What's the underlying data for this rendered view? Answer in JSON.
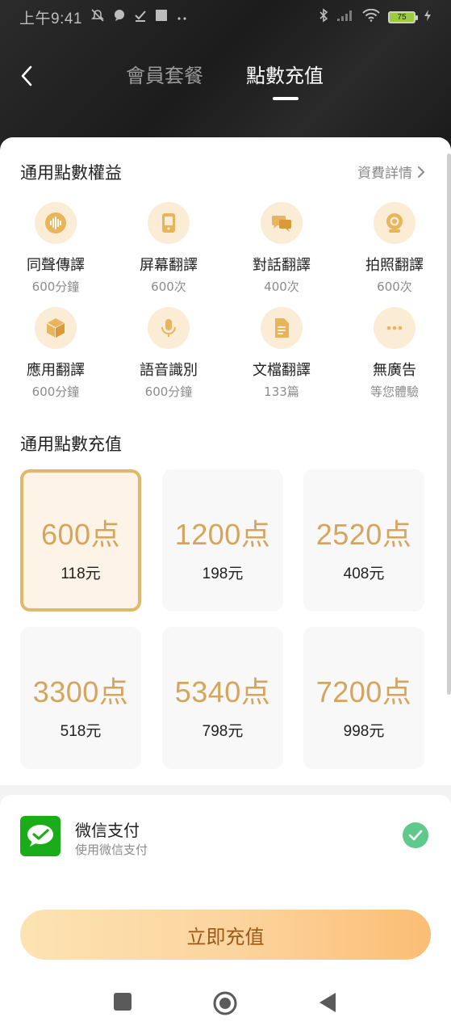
{
  "status_bar": {
    "time": "上午9:41",
    "battery": "75"
  },
  "nav": {
    "tabs": [
      {
        "label": "會員套餐",
        "active": false
      },
      {
        "label": "點數充值",
        "active": true
      }
    ]
  },
  "benefits_section": {
    "title": "通用點數權益",
    "details_link": "資費詳情",
    "items": [
      {
        "name": "同聲傳譯",
        "value": "600分鐘",
        "icon": "waveform-icon"
      },
      {
        "name": "屏幕翻譯",
        "value": "600次",
        "icon": "screen-icon"
      },
      {
        "name": "對話翻譯",
        "value": "400次",
        "icon": "chat-icon"
      },
      {
        "name": "拍照翻譯",
        "value": "600次",
        "icon": "camera-icon"
      },
      {
        "name": "應用翻譯",
        "value": "600分鐘",
        "icon": "cube-icon"
      },
      {
        "name": "語音識別",
        "value": "600分鐘",
        "icon": "microphone-icon"
      },
      {
        "name": "文檔翻譯",
        "value": "133篇",
        "icon": "document-icon"
      },
      {
        "name": "無廣告",
        "value": "等您體驗",
        "icon": "more-icon"
      }
    ]
  },
  "recharge_section": {
    "title": "通用點數充值",
    "packages": [
      {
        "points": "600点",
        "price": "118元",
        "selected": true
      },
      {
        "points": "1200点",
        "price": "198元",
        "selected": false
      },
      {
        "points": "2520点",
        "price": "408元",
        "selected": false
      },
      {
        "points": "3300点",
        "price": "518元",
        "selected": false
      },
      {
        "points": "5340点",
        "price": "798元",
        "selected": false
      },
      {
        "points": "7200点",
        "price": "998元",
        "selected": false
      }
    ]
  },
  "payment": {
    "method": "微信支付",
    "subtitle": "使用微信支付",
    "selected": true
  },
  "actions": {
    "recharge_label": "立即充值"
  },
  "colors": {
    "accent": "#d6a55d",
    "selected_border": "#e0b86a",
    "check_green": "#5fc98b",
    "wechat_green": "#1aad19"
  }
}
